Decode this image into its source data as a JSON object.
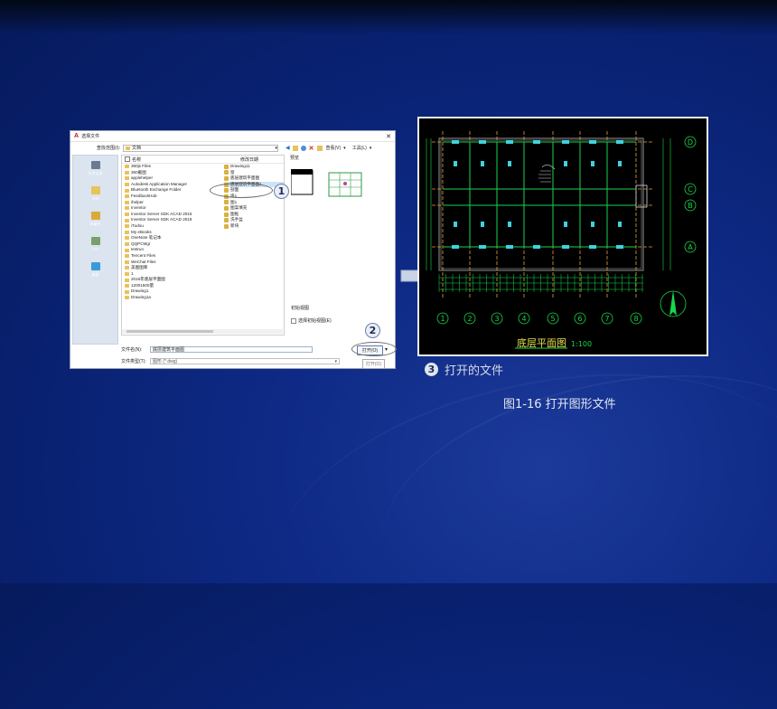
{
  "dialog": {
    "title": "选择文件",
    "look_in_label": "查找范围(I):",
    "look_in_value": "文档",
    "toolbar": {
      "views_label": "查看(V)",
      "tools_label": "工具(L)"
    },
    "places": [
      {
        "label": "历史记录",
        "icon": "history-icon"
      },
      {
        "label": "文档",
        "icon": "documents-icon"
      },
      {
        "label": "收藏夹",
        "icon": "favorites-icon"
      },
      {
        "label": "FTP",
        "icon": "ftp-icon"
      },
      {
        "label": "桌面",
        "icon": "desktop-icon"
      }
    ],
    "list": {
      "col_name": "名称",
      "col_modified": "修改日期",
      "folders": [
        "360js Files",
        "360截图",
        "applehelper",
        "Autodesk Application Manager",
        "Bluetooth Exchange Folder",
        "FeedbackHub",
        "ihelper",
        "Inventor",
        "Inventor Server SDK ACAD 2015",
        "Inventor Server SDK ACAD 2018",
        "iTudou",
        "My eBooks",
        "OneNote 笔记本",
        "QQPCMgr",
        "testrun",
        "Tencent Files",
        "WeChat Files",
        "美图图库",
        "1",
        "2016年底层平面图",
        "12001500量",
        "Drawing1",
        "Drawing1a"
      ],
      "files_col2": [
        "Drawing11",
        "窗",
        "底层建筑平面图",
        "底层建筑平面图1",
        "剖面",
        "块1",
        "图1",
        "图案填充",
        "图框",
        "洗手盆",
        "新块"
      ],
      "selected_file": "底层建筑平面图1"
    },
    "preview": {
      "label": "预览",
      "initial_view_label": "初始视图",
      "select_initial_view": "选择初始视图(E)"
    },
    "filename_label": "文件名(N):",
    "filename_value": "底层建筑平面图",
    "filetype_label": "文件类型(T):",
    "filetype_value": "图形 (*.dwg)",
    "open_button": "打开(O)",
    "open_menu_item": "打开(O)"
  },
  "callouts": [
    "1",
    "2",
    "3"
  ],
  "drawing": {
    "title": "底层平面图",
    "scale": "1:100",
    "axis_numbers": [
      "1",
      "2",
      "3",
      "4",
      "5",
      "6",
      "7",
      "8"
    ],
    "axis_letters": [
      "D",
      "C",
      "B",
      "A"
    ]
  },
  "step3_label": "打开的文件",
  "caption": "图1-16 打开图形文件",
  "colors": {
    "background": "#0e2a86",
    "drawing_lines": "#19d64a",
    "drawing_dim": "#e6a23c"
  }
}
